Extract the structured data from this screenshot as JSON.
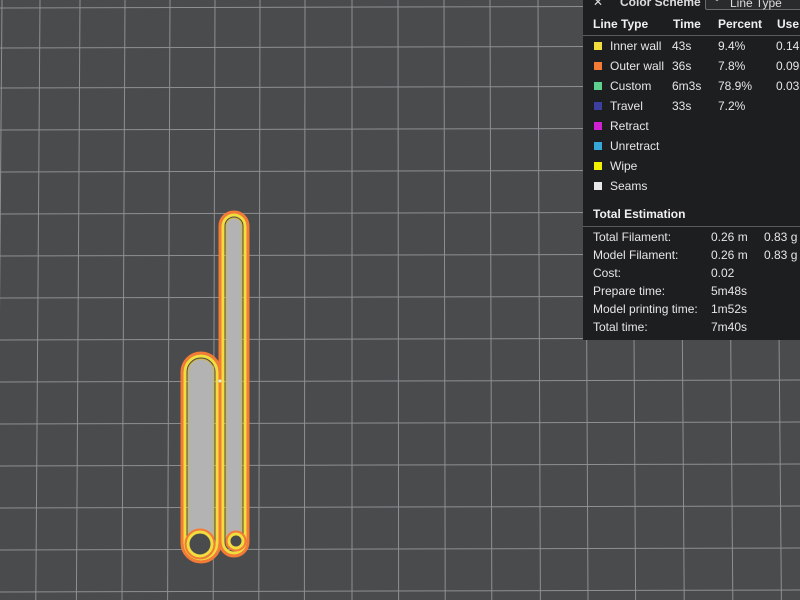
{
  "scheme_bar": {
    "close_icon": "close-icon",
    "title": "Color Scheme",
    "select_value": "Line Type",
    "chevron_icon": "chevron-down-icon"
  },
  "legend": {
    "headers": {
      "line_type": "Line Type",
      "time": "Time",
      "percent": "Percent",
      "used": "Use"
    },
    "rows": [
      {
        "label": "Inner wall",
        "time": "43s",
        "percent": "9.4%",
        "used": "0.14",
        "color": "#f2dd3e"
      },
      {
        "label": "Outer wall",
        "time": "36s",
        "percent": "7.8%",
        "used": "0.09",
        "color": "#f47a36"
      },
      {
        "label": "Custom",
        "time": "6m3s",
        "percent": "78.9%",
        "used": "0.03",
        "color": "#5fcf8f"
      },
      {
        "label": "Travel",
        "time": "33s",
        "percent": "7.2%",
        "used": "",
        "color": "#3d3f9e"
      },
      {
        "label": "Retract",
        "time": "",
        "percent": "",
        "used": "",
        "color": "#d021d0"
      },
      {
        "label": "Unretract",
        "time": "",
        "percent": "",
        "used": "",
        "color": "#36a8d8"
      },
      {
        "label": "Wipe",
        "time": "",
        "percent": "",
        "used": "",
        "color": "#f0f000"
      },
      {
        "label": "Seams",
        "time": "",
        "percent": "",
        "used": "",
        "color": "#e8e8e8"
      }
    ]
  },
  "estimation": {
    "title": "Total Estimation",
    "rows": [
      {
        "label": "Total Filament:",
        "value": "0.26 m",
        "extra": "0.83 g"
      },
      {
        "label": "Model Filament:",
        "value": "0.26 m",
        "extra": "0.83 g"
      },
      {
        "label": "Cost:",
        "value": "0.02",
        "extra": ""
      },
      {
        "label": "Prepare time:",
        "value": "5m48s",
        "extra": ""
      },
      {
        "label": "Model printing time:",
        "value": "1m52s",
        "extra": ""
      },
      {
        "label": "Total time:",
        "value": "7m40s",
        "extra": ""
      }
    ]
  },
  "colors": {
    "plate_bg": "#4a4b4d",
    "grid": "#8e8f92",
    "panel_bg": "#1d1e20",
    "inner_wall": "#f2dd3e",
    "outer_wall": "#f47a36",
    "part_fill": "#b3b3b3"
  }
}
